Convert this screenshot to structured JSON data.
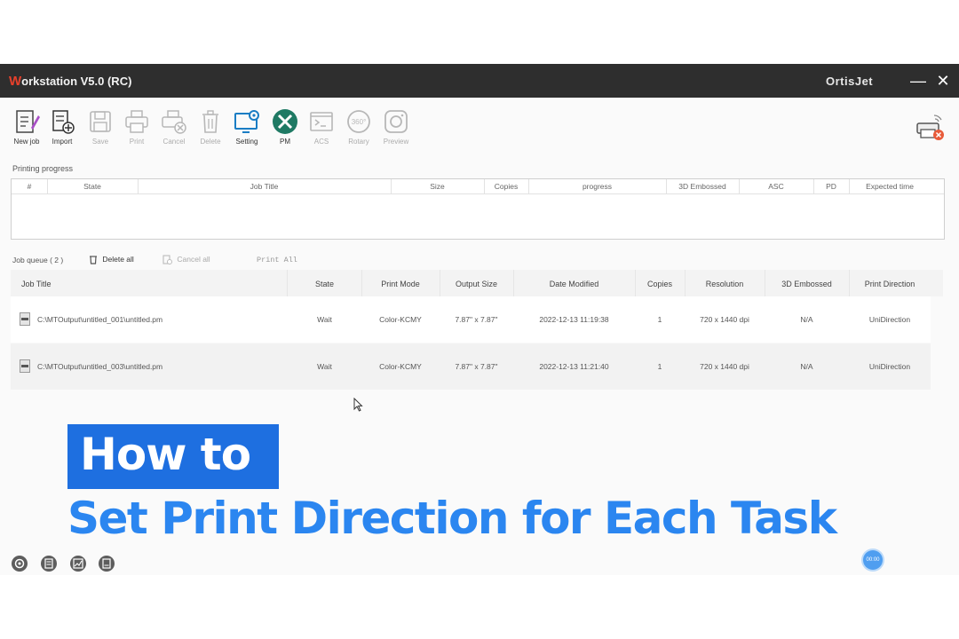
{
  "window": {
    "title_first_letter": "W",
    "title_rest": "orkstation V5.0 (RC)",
    "brand": "OrtisJet",
    "minimize_glyph": "—",
    "close_glyph": "✕"
  },
  "toolbar": {
    "items": [
      {
        "label": "New job",
        "icon": "new-job-icon",
        "enabled": true
      },
      {
        "label": "Import",
        "icon": "import-icon",
        "enabled": true
      },
      {
        "label": "Save",
        "icon": "save-icon",
        "enabled": false
      },
      {
        "label": "Print",
        "icon": "print-icon",
        "enabled": false
      },
      {
        "label": "Cancel",
        "icon": "cancel-print-icon",
        "enabled": false
      },
      {
        "label": "Delete",
        "icon": "trash-icon",
        "enabled": false
      },
      {
        "label": "Setting",
        "icon": "monitor-gear-icon",
        "enabled": true
      },
      {
        "label": "PM",
        "icon": "wrench-screwdriver-icon",
        "enabled": true
      },
      {
        "label": "ACS",
        "icon": "terminal-icon",
        "enabled": false
      },
      {
        "label": "Rotary",
        "icon": "rotary-360-icon",
        "enabled": false
      },
      {
        "label": "Preview",
        "icon": "camera-icon",
        "enabled": false
      }
    ],
    "rotary_badge": "360°"
  },
  "printing_progress": {
    "label": "Printing progress",
    "columns": [
      "#",
      "State",
      "Job Title",
      "Size",
      "Copies",
      "progress",
      "3D Embossed",
      "ASC",
      "PD",
      "Expected time"
    ]
  },
  "job_queue": {
    "label": "Job queue ( 2 )",
    "delete_all": "Delete all",
    "cancel_all": "Cancel all",
    "print_all": "Print All",
    "columns": [
      "Job Title",
      "State",
      "Print Mode",
      "Output Size",
      "Date Modified",
      "Copies",
      "Resolution",
      "3D Embossed",
      "Print Direction"
    ],
    "rows": [
      {
        "title": "C:\\MTOutput\\untitled_001\\untitled.pm",
        "state": "Wait",
        "mode": "Color-KCMY",
        "size": "7.87\" x 7.87\"",
        "date": "2022-12-13 11:19:38",
        "copies": "1",
        "resolution": "720 x 1440 dpi",
        "embossed": "N/A",
        "direction": "UniDirection"
      },
      {
        "title": "C:\\MTOutput\\untitled_003\\untitled.pm",
        "state": "Wait",
        "mode": "Color-KCMY",
        "size": "7.87\" x 7.87\"",
        "date": "2022-12-13 11:21:40",
        "copies": "1",
        "resolution": "720 x 1440 dpi",
        "embossed": "N/A",
        "direction": "UniDirection"
      }
    ]
  },
  "footer": {
    "icons": [
      "settings-gear-icon",
      "calculator-icon",
      "chart-icon",
      "document-icon"
    ],
    "timer": "00:00"
  },
  "overlay": {
    "line1": "How to",
    "line2": "Set Print Direction for Each Task",
    "accent_color": "#1e6fe0",
    "text_color": "#2b86f0"
  }
}
